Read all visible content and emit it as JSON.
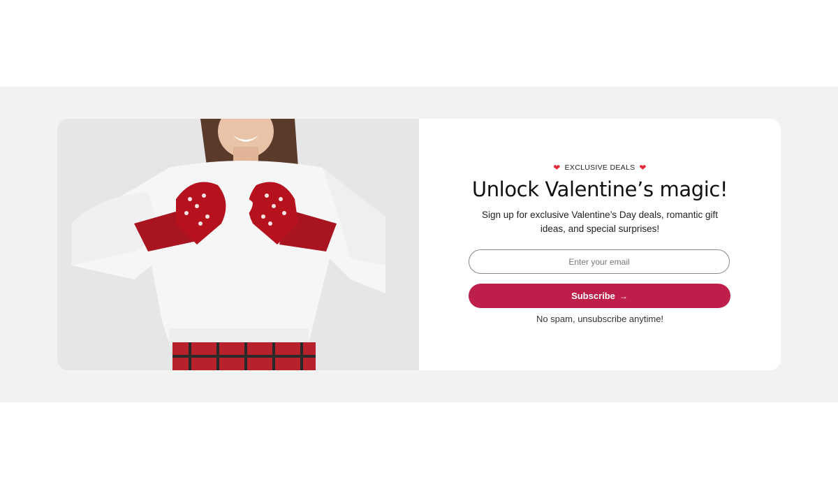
{
  "signup": {
    "eyebrow": "EXCLUSIVE DEALS",
    "headline": "Unlock Valentine’s magic!",
    "description": "Sign up for exclusive Valentine’s Day deals, romantic gift ideas, and special surprises!",
    "email_placeholder": "Enter your email",
    "button_label": "Subscribe",
    "note": "No spam, unsubscribe anytime!"
  },
  "icons": {
    "eyebrow_left": "heart-icon",
    "eyebrow_right": "heart-icon",
    "button": "arrow-right-icon"
  },
  "colors": {
    "page_band": "#f3f2f0",
    "accent": "#be1e4a",
    "heart": "#e02a3a"
  }
}
